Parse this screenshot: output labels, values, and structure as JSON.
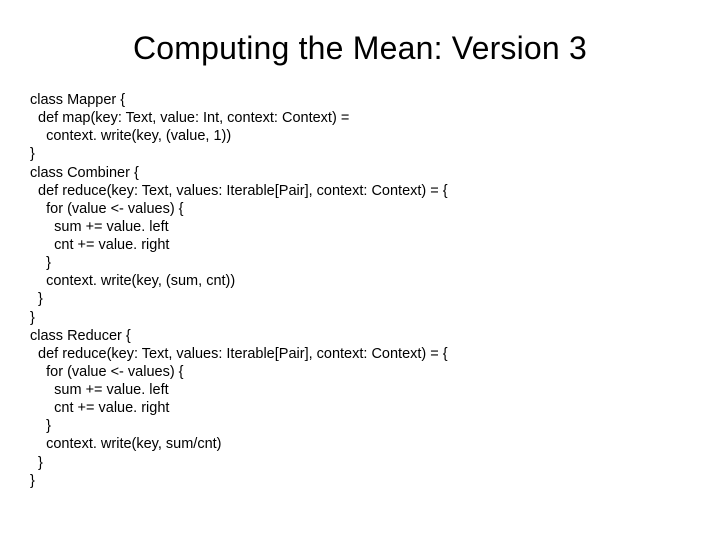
{
  "title": "Computing the Mean: Version 3",
  "code": "class Mapper {\n  def map(key: Text, value: Int, context: Context) =\n    context. write(key, (value, 1))\n}\nclass Combiner {\n  def reduce(key: Text, values: Iterable[Pair], context: Context) = {\n    for (value <- values) {\n      sum += value. left\n      cnt += value. right\n    }\n    context. write(key, (sum, cnt))\n  }\n}\nclass Reducer {\n  def reduce(key: Text, values: Iterable[Pair], context: Context) = {\n    for (value <- values) {\n      sum += value. left\n      cnt += value. right\n    }\n    context. write(key, sum/cnt)\n  }\n}"
}
